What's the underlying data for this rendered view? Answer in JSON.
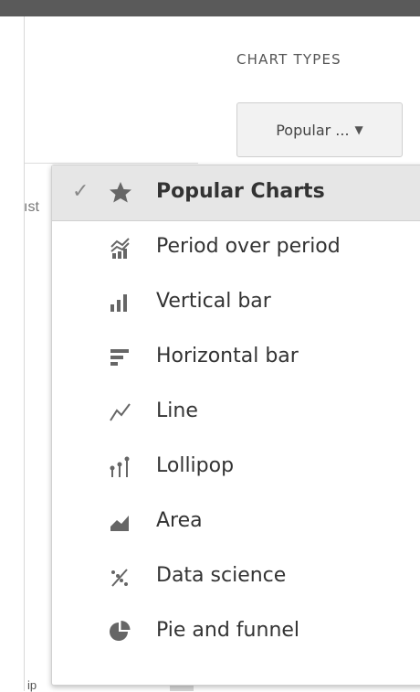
{
  "header": {
    "section_label": "CHART TYPES",
    "selector_value": "Popular ...",
    "selector_chevron": "chevron-down-icon"
  },
  "background": {
    "left_peek_text": "ıst",
    "bottom_peek_text": "ip"
  },
  "menu": {
    "items": [
      {
        "label": "Popular Charts",
        "icon": "star-icon",
        "selected": true
      },
      {
        "label": "Period over period",
        "icon": "period-over-period-icon",
        "selected": false
      },
      {
        "label": "Vertical bar",
        "icon": "vertical-bar-icon",
        "selected": false
      },
      {
        "label": "Horizontal bar",
        "icon": "horizontal-bar-icon",
        "selected": false
      },
      {
        "label": "Line",
        "icon": "line-chart-icon",
        "selected": false
      },
      {
        "label": "Lollipop",
        "icon": "lollipop-icon",
        "selected": false
      },
      {
        "label": "Area",
        "icon": "area-chart-icon",
        "selected": false
      },
      {
        "label": "Data science",
        "icon": "data-science-icon",
        "selected": false
      },
      {
        "label": "Pie and funnel",
        "icon": "pie-chart-icon",
        "selected": false
      }
    ]
  },
  "colors": {
    "selected_bg": "#e6e6e6",
    "icon": "#666666",
    "text": "#333333"
  }
}
